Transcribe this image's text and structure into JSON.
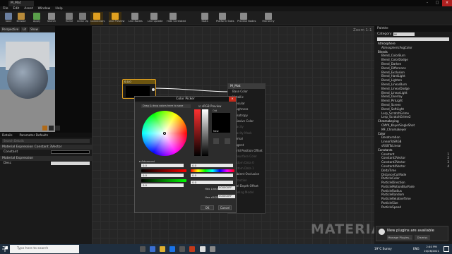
{
  "window": {
    "tab_title": "M_Mat",
    "menu": [
      "File",
      "Edit",
      "Asset",
      "Window",
      "Help"
    ]
  },
  "toolbar": {
    "buttons": [
      "Save",
      "Browse",
      "Apply",
      "Search",
      "Home",
      "Clean Up",
      "Connectors",
      "Live Preview",
      "Live Nodes",
      "Live Update",
      "Hide Unrelated",
      "Stats",
      "Platform Stats",
      "Preview Nodes",
      "Hierarchy"
    ]
  },
  "viewport": {
    "perspective_label": "Perspective",
    "lit_label": "Lit",
    "show_label": "Show"
  },
  "details": {
    "tabs": [
      "Details",
      "Parameter Defaults"
    ],
    "search_placeholder": "Search Details",
    "section1": "Material Expression Constant 3Vector",
    "constant_label": "Constant",
    "section2": "Material Expression",
    "desc_label": "Desc"
  },
  "graph": {
    "zoom": "Zoom 1:1",
    "watermark": "MATERIAL",
    "node1_title": "0,0,0",
    "node2_title": "M_Mat",
    "node2_pins": [
      "Base Color",
      "Metallic",
      "Specular",
      "Roughness",
      "Anisotropy",
      "Emissive Color",
      "Opacity",
      "Opacity Mask",
      "Normal",
      "Tangent",
      "World Position Offset",
      "Subsurface Color",
      "Custom Data 0",
      "Custom Data 1",
      "Ambient Occlusion",
      "Refraction",
      "Pixel Depth Offset",
      "Shading Model"
    ]
  },
  "color_picker": {
    "title": "Color Picker",
    "hint": "Drag & drop colors here to save",
    "srgb_label": "sRGB Preview",
    "old_label": "Old",
    "new_label": "New",
    "advanced_label": "Advanced",
    "values": [
      "0.0",
      "0.0",
      "0.0",
      "0.0",
      "0.0",
      "0.0"
    ],
    "hex_linear_label": "Hex Linear",
    "hex_linear_value": "000000FF",
    "hex_srgb_label": "Hex sRGB",
    "hex_srgb_value": "000000FF",
    "ok_label": "OK",
    "cancel_label": "Cancel"
  },
  "palette": {
    "tab": "Palette",
    "category_label": "Category",
    "category_value": "All",
    "items": [
      {
        "t": "Atmosphere",
        "cat": true
      },
      {
        "t": "AtmosphericFogColor"
      },
      {
        "t": "Blends",
        "cat": true
      },
      {
        "t": "Blend_ColorBurn"
      },
      {
        "t": "Blend_ColorDodge"
      },
      {
        "t": "Blend_Darken"
      },
      {
        "t": "Blend_Difference"
      },
      {
        "t": "Blend_Exclusion"
      },
      {
        "t": "Blend_HardLight"
      },
      {
        "t": "Blend_Lighten"
      },
      {
        "t": "Blend_LinearBurn"
      },
      {
        "t": "Blend_LinearDodge"
      },
      {
        "t": "Blend_LinearLight"
      },
      {
        "t": "Blend_Overlay"
      },
      {
        "t": "Blend_PinLight"
      },
      {
        "t": "Blend_Screen"
      },
      {
        "t": "Blend_SoftLight"
      },
      {
        "t": "Lerp_ScratchGrime"
      },
      {
        "t": "Lerp_ScratchGrime2"
      },
      {
        "t": "Chromakeying",
        "cat": true
      },
      {
        "t": "CMYK_KeyerSingleShot"
      },
      {
        "t": "MF_Chromakeyer"
      },
      {
        "t": "Color",
        "cat": true
      },
      {
        "t": "Desaturation"
      },
      {
        "t": "LinearToSRGB"
      },
      {
        "t": "sRGBToLinear"
      },
      {
        "t": "Constants",
        "cat": true
      },
      {
        "t": "Constant",
        "k": "1"
      },
      {
        "t": "Constant2Vector",
        "k": "2"
      },
      {
        "t": "Constant3Vector",
        "k": "3"
      },
      {
        "t": "Constant4Vector",
        "k": "4"
      },
      {
        "t": "DeltaTime"
      },
      {
        "t": "DistanceCullFade"
      },
      {
        "t": "ParticleColor"
      },
      {
        "t": "ParticleDirection"
      },
      {
        "t": "ParticleMotionBlurFade"
      },
      {
        "t": "ParticleRadius"
      },
      {
        "t": "ParticleRandom"
      },
      {
        "t": "ParticleRelativeTime"
      },
      {
        "t": "ParticleSize"
      },
      {
        "t": "ParticleSpeed"
      }
    ]
  },
  "toast": {
    "text": "New plugins are available",
    "manage_label": "Manage Plugins...",
    "dismiss_label": "Dismiss"
  },
  "taskbar": {
    "search_placeholder": "Type here to search",
    "weather": "19°C Sunny",
    "lang": "ENG",
    "time": "2:40 PM",
    "date": "10/26/2021"
  }
}
